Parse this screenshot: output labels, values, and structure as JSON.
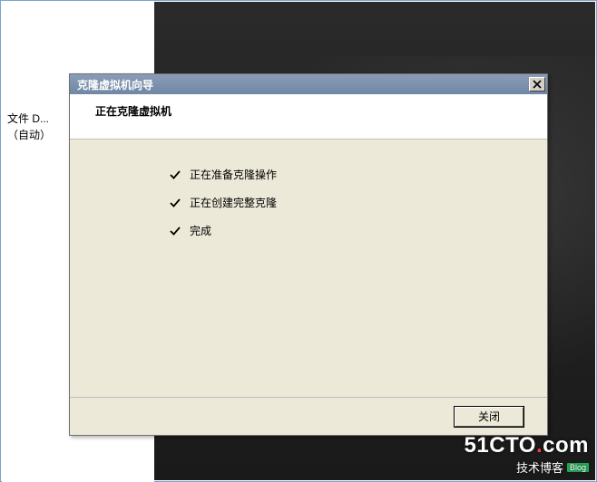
{
  "left_pane": {
    "line1": "文件 D...",
    "line2": "（自动）"
  },
  "dialog": {
    "title": "克隆虚拟机向导",
    "header": "正在克隆虚拟机",
    "steps": [
      "正在准备克隆操作",
      "正在创建完整克隆",
      "完成"
    ],
    "close_button": "关闭"
  },
  "watermark": {
    "main_a": "51CTO",
    "main_b": "com",
    "sub": "技术博客",
    "blog": "Blog"
  }
}
